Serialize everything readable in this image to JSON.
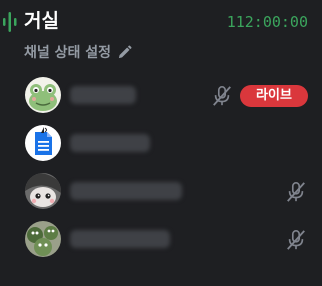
{
  "channel": {
    "name": "거실",
    "timer": "112:00:00",
    "status_label": "채널 상태 설정"
  },
  "members": [
    {
      "avatar": "frog-avatar",
      "muted": true,
      "live": true,
      "live_label": "라이브"
    },
    {
      "avatar": "document-icon-avatar",
      "muted": false,
      "live": false
    },
    {
      "avatar": "character-avatar",
      "muted": true,
      "live": false
    },
    {
      "avatar": "frog-group-avatar",
      "muted": true,
      "live": false
    }
  ],
  "colors": {
    "background": "#1e1f22",
    "timer": "#3ba55d",
    "live_badge": "#da373c",
    "muted_text": "#949ba4"
  }
}
